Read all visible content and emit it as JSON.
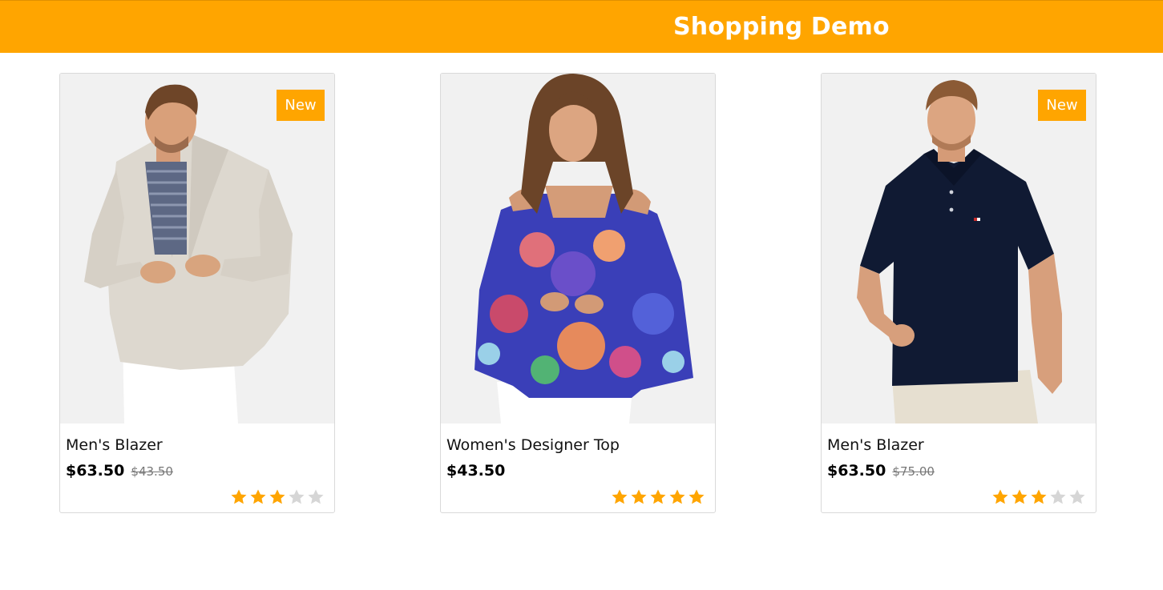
{
  "header": {
    "title": "Shopping Demo",
    "color": "#ffa500"
  },
  "products": [
    {
      "name": "Men's Blazer",
      "price": "$63.50",
      "old_price": "$43.50",
      "badge": "New",
      "rating": 3,
      "rating_max": 5,
      "image": "man-in-linen-blazer"
    },
    {
      "name": "Women's Designer Top",
      "price": "$43.50",
      "old_price": "",
      "badge": "",
      "rating": 5,
      "rating_max": 5,
      "image": "woman-in-floral-cold-shoulder-top"
    },
    {
      "name": "Men's Blazer",
      "price": "$63.50",
      "old_price": "$75.00",
      "badge": "New",
      "rating": 3,
      "rating_max": 5,
      "image": "man-in-navy-polo-shirt"
    }
  ],
  "colors": {
    "accent": "#ffa500",
    "star_filled": "#ffa500",
    "star_empty": "#d6d6d6"
  }
}
